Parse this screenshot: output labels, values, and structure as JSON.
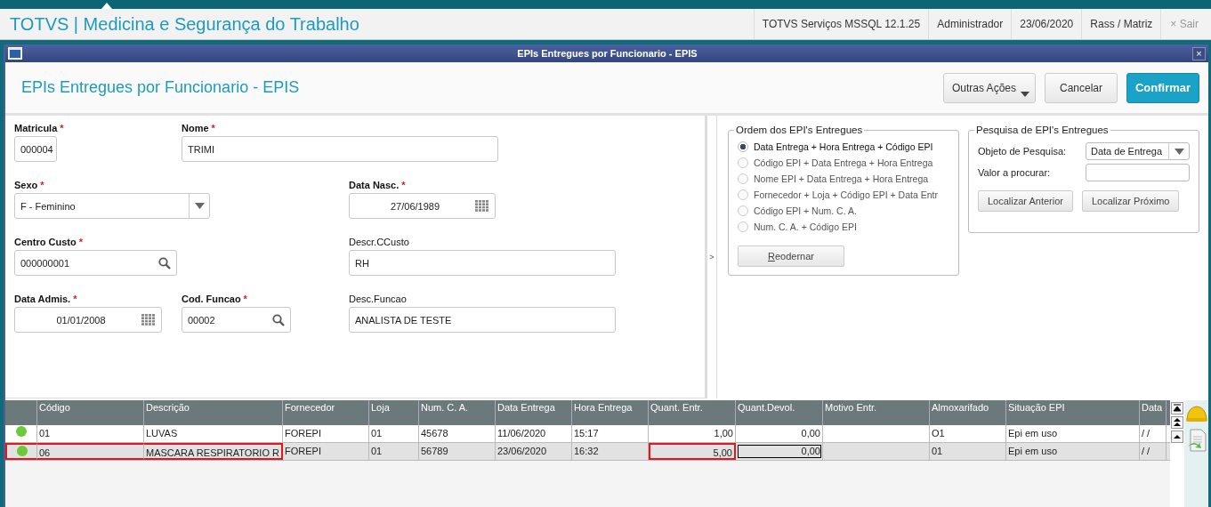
{
  "app_header": {
    "title": "TOTVS | Medicina e Segurança do Trabalho",
    "info": [
      "TOTVS Serviços MSSQL 12.1.25",
      "Administrador",
      "23/06/2020",
      "Rass / Matriz"
    ],
    "exit": {
      "icon": "×",
      "label": "Sair",
      "disabled": true
    }
  },
  "window": {
    "title": "EPIs Entregues por Funcionario - EPIS",
    "close": "×"
  },
  "page": {
    "title": "EPIs Entregues por Funcionario - EPIS",
    "buttons": [
      {
        "label": "Outras Ações",
        "kind": "menu"
      },
      {
        "label": "Cancelar",
        "kind": "plain"
      },
      {
        "label": "Confirmar",
        "kind": "primary"
      }
    ]
  },
  "form": {
    "rows": [
      [
        {
          "label": "Matricula",
          "required_mark": "*",
          "value": "000004",
          "kind": "text"
        },
        {
          "label": "Nome",
          "required_mark": "*",
          "value": "TRIMI",
          "kind": "text"
        },
        null
      ],
      [
        {
          "label": "Sexo",
          "required_mark": "*",
          "value": "F - Feminino",
          "kind": "select"
        },
        null,
        {
          "label": "Data Nasc.",
          "required_mark": "*",
          "value": "27/06/1989",
          "kind": "date"
        }
      ],
      [
        {
          "label": "Centro Custo",
          "required_mark": "*",
          "value": "000000001",
          "kind": "lookup"
        },
        null,
        {
          "label": "Descr.CCusto",
          "value": "RH",
          "kind": "text"
        }
      ],
      [
        {
          "label": "Data Admis.",
          "required_mark": "*",
          "value": "01/01/2008",
          "kind": "date"
        },
        {
          "label": "Cod. Funcao",
          "required_mark": "*",
          "value": "00002",
          "kind": "lookup"
        },
        {
          "label": "Desc.Funcao",
          "value": "ANALISTA DE TESTE",
          "kind": "text"
        }
      ]
    ]
  },
  "splitter": ">",
  "order_panel": {
    "title": "Ordem dos EPI's Entregues",
    "options": [
      {
        "label": "Data Entrega + Hora Entrega + Código EPI",
        "selected": true
      },
      {
        "label": "Código EPI + Data Entrega + Hora Entrega",
        "selected": false
      },
      {
        "label": "Nome EPI + Data Entrega + Hora Entrega",
        "selected": false
      },
      {
        "label": "Fornecedor + Loja + Código EPI + Data Entr",
        "selected": false
      },
      {
        "label": "Código EPI +  Num. C. A.",
        "selected": false
      },
      {
        "label": "Num. C. A. + Código EPI",
        "selected": false
      }
    ],
    "button": "Reodernar"
  },
  "search_panel": {
    "title": "Pesquisa de EPI's Entregues",
    "object_label": "Objeto de Pesquisa:",
    "object_value": "Data de Entrega",
    "value_label": "Valor a procurar:",
    "buttons": [
      "Localizar Anterior",
      "Localizar Próximo"
    ]
  },
  "table": {
    "columns": [
      "",
      "Código",
      "Descrição",
      "Fornecedor",
      "Loja",
      "Num. C. A.",
      "Data Entrega",
      "Hora Entrega",
      "Quant. Entr.",
      "Quant.Devol.",
      "Motivo Entr.",
      "Almoxarifado",
      "Situação EPI",
      "Data"
    ],
    "rows": [
      {
        "selected": false,
        "cells": [
          {
            "color": "#6cc93a",
            "highlighted": false
          },
          {
            "text": "01",
            "highlighted": false
          },
          {
            "text": "LUVAS",
            "highlighted": false
          },
          {
            "text": "FOREPI",
            "highlighted": false
          },
          {
            "text": "01",
            "highlighted": false
          },
          {
            "text": "45678",
            "highlighted": false
          },
          {
            "text": "11/06/2020",
            "highlighted": false
          },
          {
            "text": "15:17",
            "highlighted": false
          },
          {
            "text": "1,00",
            "highlighted": false
          },
          {
            "text": "0,00",
            "highlighted": false
          },
          {
            "text": "",
            "highlighted": false
          },
          {
            "text": "O1",
            "highlighted": false
          },
          {
            "text": "Epi em uso",
            "highlighted": false
          },
          {
            "text": "/ /",
            "highlighted": false
          }
        ]
      },
      {
        "selected": true,
        "cells": [
          {
            "color": "#6cc93a",
            "highlighted": true
          },
          {
            "text": "06",
            "highlighted": true
          },
          {
            "text": "MASCARA RESPIRATORIO R",
            "highlighted": true
          },
          {
            "text": "FOREPI",
            "highlighted": false
          },
          {
            "text": "01",
            "highlighted": false
          },
          {
            "text": "56789",
            "highlighted": false
          },
          {
            "text": "23/06/2020",
            "highlighted": false
          },
          {
            "text": "16:32",
            "highlighted": false
          },
          {
            "text": "5,00",
            "highlighted": true
          },
          {
            "text": "0,00",
            "highlighted": false
          },
          {
            "text": "",
            "highlighted": false
          },
          {
            "text": "01",
            "highlighted": false
          },
          {
            "text": "Epi em uso",
            "highlighted": false
          },
          {
            "text": "/ /",
            "highlighted": false
          }
        ]
      }
    ]
  }
}
